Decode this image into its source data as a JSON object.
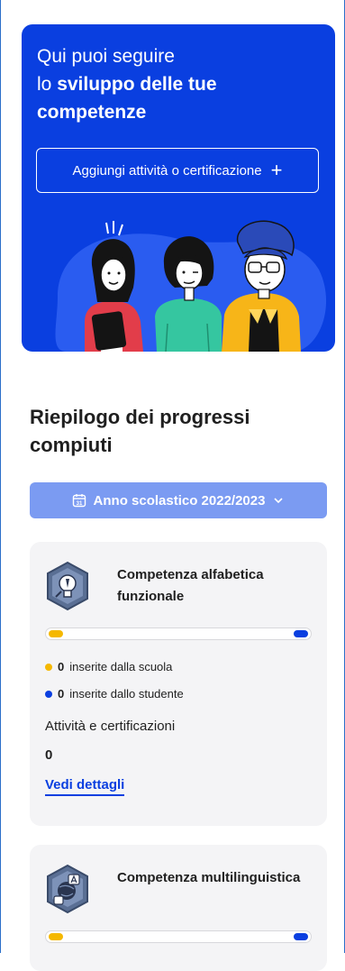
{
  "hero": {
    "title_line1": "Qui puoi seguire",
    "title_line2_prefix": "lo ",
    "title_line2_bold": "sviluppo delle tue",
    "title_line3_bold": "competenze",
    "add_button_label": "Aggiungi attività o certificazione",
    "add_button_icon": "plus-icon"
  },
  "summary": {
    "title": "Riepilogo dei progressi compiuti",
    "year_select": {
      "icon": "calendar-icon",
      "calendar_day": "31",
      "label": "Anno scolastico 2022/2023",
      "chevron": "chevron-down-icon"
    }
  },
  "colors": {
    "primary_blue": "#0a3fe0",
    "select_blue": "#7b9bf2",
    "school_yellow": "#f5b800",
    "card_bg": "#f4f4f6"
  },
  "competences": [
    {
      "title": "Competenza alfabetica funzionale",
      "icon": "lightbulb-pencil-badge-icon",
      "school_count": "0",
      "school_label": "inserite dalla scuola",
      "student_count": "0",
      "student_label": "inserite dallo studente",
      "activities_label": "Attività e certificazioni",
      "activities_count": "0",
      "details_link": "Vedi dettagli"
    },
    {
      "title": "Competenza multilinguistica",
      "icon": "globe-language-badge-icon"
    }
  ]
}
